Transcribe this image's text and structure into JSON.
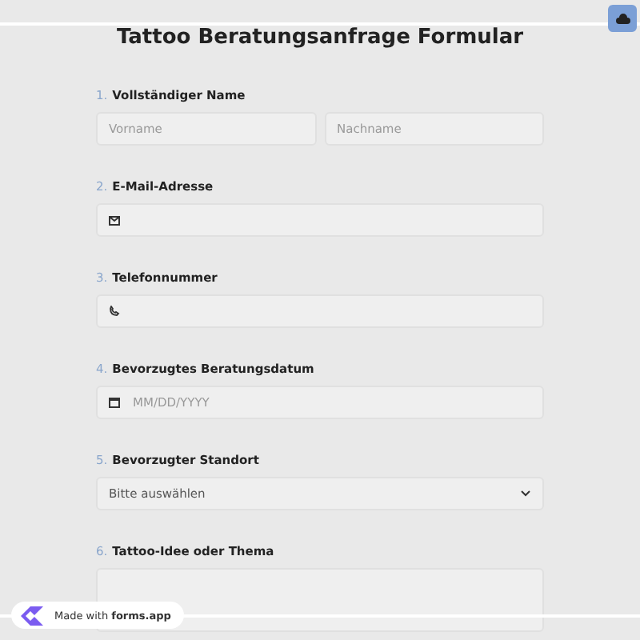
{
  "title": "Tattoo Beratungsanfrage Formular",
  "questions": [
    {
      "number": "1.",
      "label": "Vollständiger Name",
      "kind": "name",
      "placeholders": [
        "Vorname",
        "Nachname"
      ]
    },
    {
      "number": "2.",
      "label": "E-Mail-Adresse",
      "kind": "email"
    },
    {
      "number": "3.",
      "label": "Telefonnummer",
      "kind": "phone"
    },
    {
      "number": "4.",
      "label": "Bevorzugtes Beratungsdatum",
      "kind": "date",
      "placeholder": "MM/DD/YYYY"
    },
    {
      "number": "5.",
      "label": "Bevorzugter Standort",
      "kind": "select",
      "value": "Bitte auswählen"
    },
    {
      "number": "6.",
      "label": "Tattoo-Idee oder Thema",
      "kind": "textarea"
    }
  ],
  "badge": {
    "text": "Made with **forms.app**"
  }
}
